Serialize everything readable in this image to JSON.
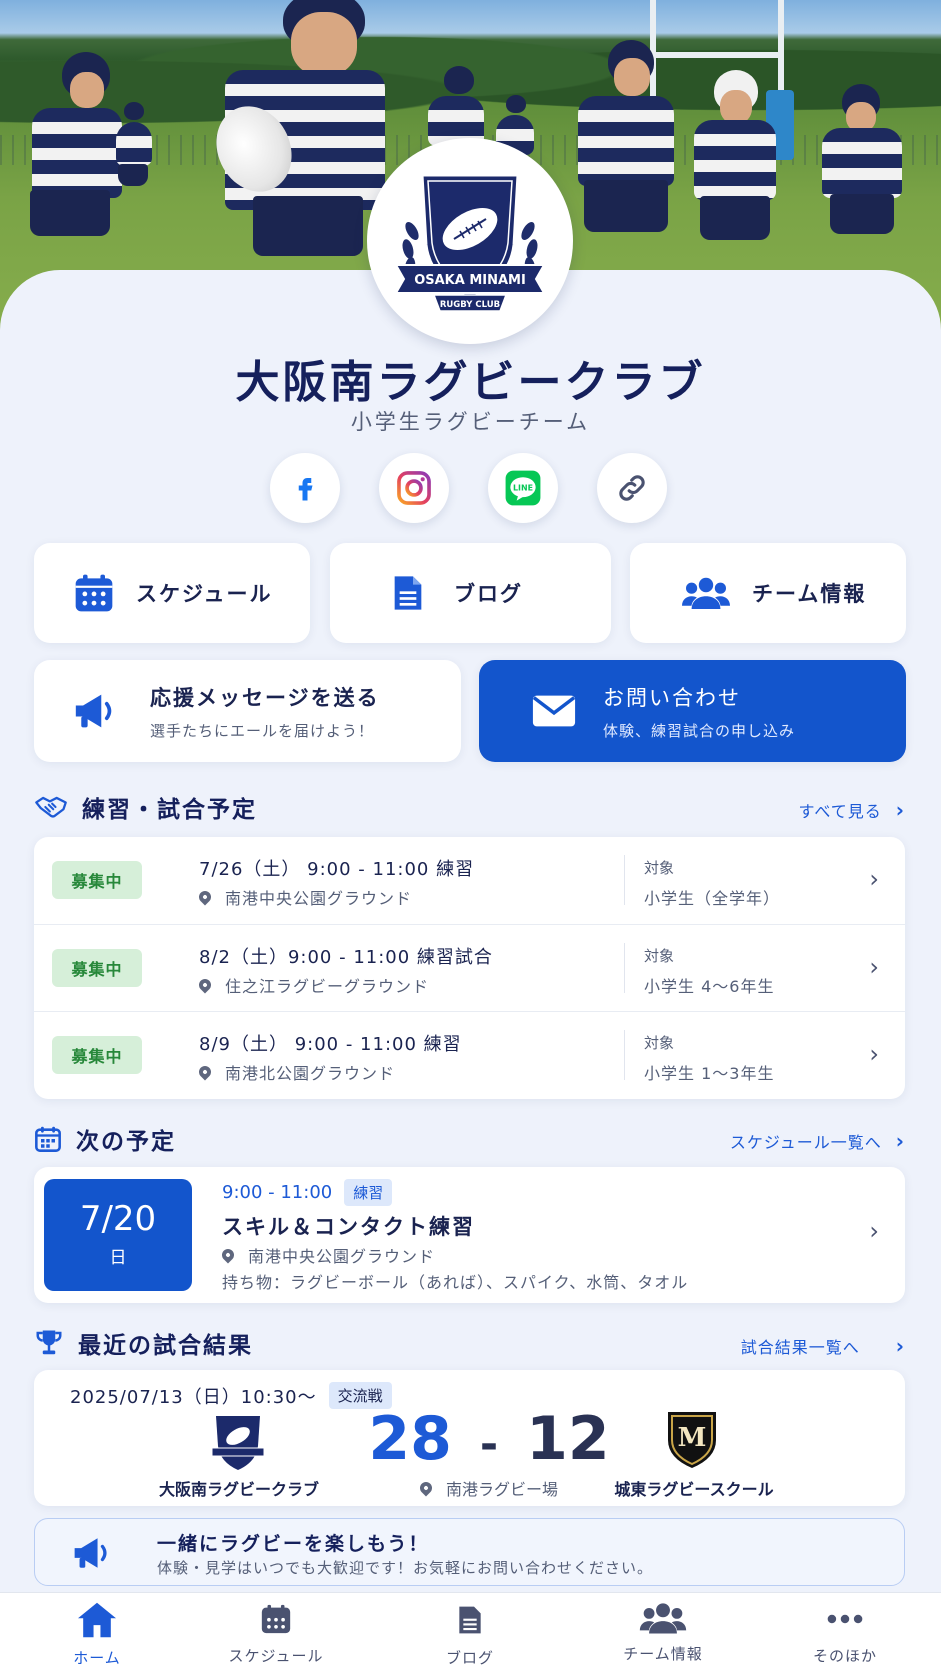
{
  "club": {
    "crest_text_top": "OSAKA MINAMI",
    "crest_text_bottom": "RUGBY CLUB",
    "name": "大阪南ラグビークラブ",
    "subtitle": "小学生ラグビーチーム"
  },
  "social": [
    {
      "icon": "facebook-icon"
    },
    {
      "icon": "instagram-icon"
    },
    {
      "icon": "line-icon",
      "label": "LINE"
    },
    {
      "icon": "link-icon"
    }
  ],
  "quick_links": {
    "schedule": "スケジュール",
    "blog": "ブログ",
    "team": "チーム情報"
  },
  "cheer": {
    "title": "応援メッセージを送る",
    "sub": "選手たちにエールを届けよう！"
  },
  "contact": {
    "title": "お問い合わせ",
    "sub": "体験、練習試合の申し込み"
  },
  "practice": {
    "heading": "練習・試合予定",
    "more": "すべて見る",
    "items": [
      {
        "badge": "募集中",
        "when": "7/26（土） 9:00 - 11:00  練習",
        "where": "南港中央公園グラウンド",
        "target_label": "対象",
        "target": "小学生（全学年）"
      },
      {
        "badge": "募集中",
        "when": "8/2（土）9:00 - 11:00  練習試合",
        "where": "住之江ラグビーグラウンド",
        "target_label": "対象",
        "target": "小学生 4～6年生"
      },
      {
        "badge": "募集中",
        "when": "8/9（土） 9:00 - 11:00  練習",
        "where": "南港北公園グラウンド",
        "target_label": "対象",
        "target": "小学生 1～3年生"
      }
    ]
  },
  "next": {
    "heading": "次の予定",
    "more": "スケジュール一覧へ",
    "date": "7/20",
    "weekday": "日",
    "time": "9:00 - 11:00",
    "tag": "練習",
    "title": "スキル＆コンタクト練習",
    "place": "南港中央公園グラウンド",
    "items": "持ち物：ラグビーボール（あれば）、スパイク、水筒、タオル"
  },
  "results": {
    "heading": "最近の試合結果",
    "more": "試合結果一覧へ",
    "datetime": "2025/07/13（日）10:30～",
    "tag": "交流戦",
    "home_team": "大阪南ラグビークラブ",
    "home_score": "28",
    "dash": "-",
    "away_score": "12",
    "away_team": "城東ラグビースクール",
    "away_crest_letter": "M",
    "venue": "南港ラグビー場"
  },
  "banner": {
    "title": "一緒にラグビーを楽しもう！",
    "sub": "体験・見学はいつでも大歓迎です！お気軽にお問い合わせください。"
  },
  "tabs": [
    {
      "label": "ホーム",
      "icon": "home-icon",
      "active": true
    },
    {
      "label": "スケジュール",
      "icon": "calendar-icon"
    },
    {
      "label": "ブログ",
      "icon": "document-icon"
    },
    {
      "label": "チーム情報",
      "icon": "users-icon"
    },
    {
      "label": "そのほか",
      "icon": "more-icon"
    }
  ],
  "colors": {
    "primary": "#1355cc",
    "navy": "#15205c",
    "badge_green": "#27883a"
  }
}
